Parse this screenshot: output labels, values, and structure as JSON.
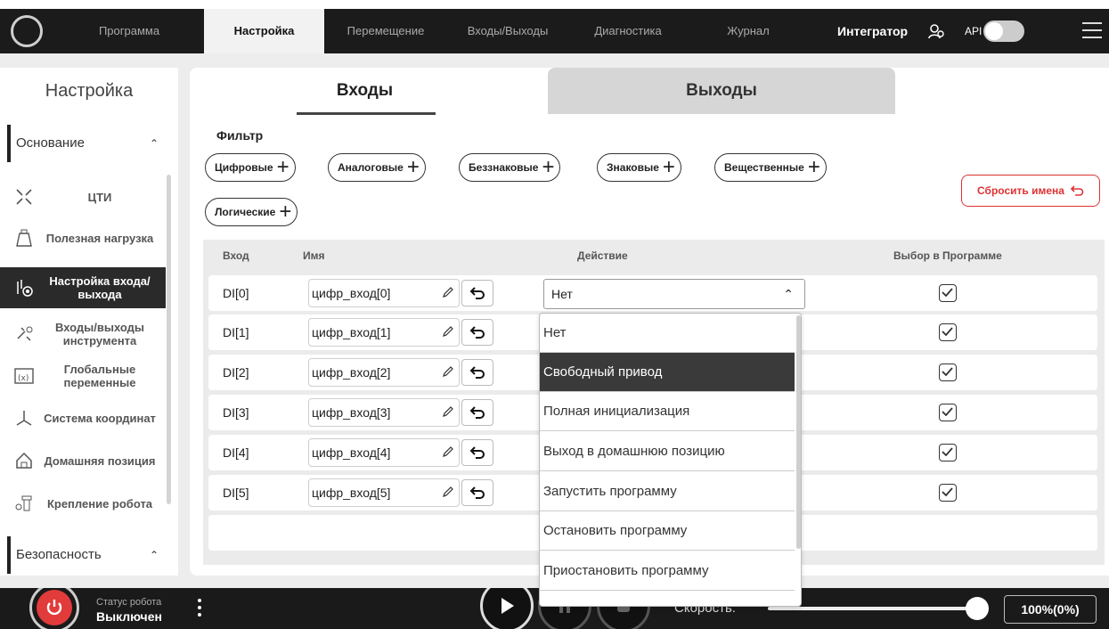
{
  "topbar": {
    "tabs": [
      {
        "label": "Программа",
        "active": false
      },
      {
        "label": "Настройка",
        "active": true
      },
      {
        "label": "Перемещение",
        "active": false
      },
      {
        "label": "Входы/Выходы",
        "active": false
      },
      {
        "label": "Диагностика",
        "active": false
      },
      {
        "label": "Журнал",
        "active": false
      }
    ],
    "user": "Интегратор",
    "api_label": "API",
    "api_enabled": false
  },
  "sidebar": {
    "title": "Настройка",
    "sections": [
      {
        "label": "Основание",
        "expanded": true
      },
      {
        "label": "Безопасность",
        "expanded": true
      }
    ],
    "items": [
      {
        "label": "ЦТИ",
        "icon": "tcp-icon",
        "active": false
      },
      {
        "label": "Полезная нагрузка",
        "icon": "weight-icon",
        "active": false
      },
      {
        "label": "Настройка входа/выхода",
        "icon": "io-settings-icon",
        "active": true
      },
      {
        "label": "Входы/выходы инструмента",
        "icon": "tool-io-icon",
        "active": false
      },
      {
        "label": "Глобальные переменные",
        "icon": "variables-icon",
        "active": false
      },
      {
        "label": "Система координат",
        "icon": "axes-icon",
        "active": false
      },
      {
        "label": "Домашняя позиция",
        "icon": "home-icon",
        "active": false
      },
      {
        "label": "Крепление робота",
        "icon": "mount-icon",
        "active": false
      }
    ]
  },
  "main": {
    "tabs": [
      {
        "label": "Входы",
        "active": true
      },
      {
        "label": "Выходы",
        "active": false
      }
    ],
    "filter": {
      "title": "Фильтр",
      "chips": [
        "Цифровые",
        "Аналоговые",
        "Беззнаковые",
        "Знаковые",
        "Вещественные",
        "Логические"
      ]
    },
    "reset_label": "Сбросить имена",
    "table": {
      "headers": [
        "Вход",
        "Имя",
        "Действие",
        "Выбор в Программе"
      ],
      "rows": [
        {
          "input": "DI[0]",
          "name": "цифр_вход[0]",
          "action": "Нет",
          "selected": true
        },
        {
          "input": "DI[1]",
          "name": "цифр_вход[1]",
          "action": "",
          "selected": true
        },
        {
          "input": "DI[2]",
          "name": "цифр_вход[2]",
          "action": "",
          "selected": true
        },
        {
          "input": "DI[3]",
          "name": "цифр_вход[3]",
          "action": "",
          "selected": true
        },
        {
          "input": "DI[4]",
          "name": "цифр_вход[4]",
          "action": "",
          "selected": true
        },
        {
          "input": "DI[5]",
          "name": "цифр_вход[5]",
          "action": "",
          "selected": true
        }
      ]
    },
    "dropdown": {
      "options": [
        "Нет",
        "Свободный привод",
        "Полная инициализация",
        "Выход в домашнюю позицию",
        "Запустить программу",
        "Остановить программу",
        "Приостановить программу"
      ],
      "highlighted": "Свободный привод"
    }
  },
  "bottombar": {
    "status_label": "Статус робота",
    "status_value": "Выключен",
    "speed_label": "Скорость:",
    "speed_value": "100%(0%)",
    "speed_fraction": 1.0
  },
  "colors": {
    "accent_red": "#e23b3b",
    "dark": "#1b1b1b",
    "active_item": "#2a2a2a"
  }
}
